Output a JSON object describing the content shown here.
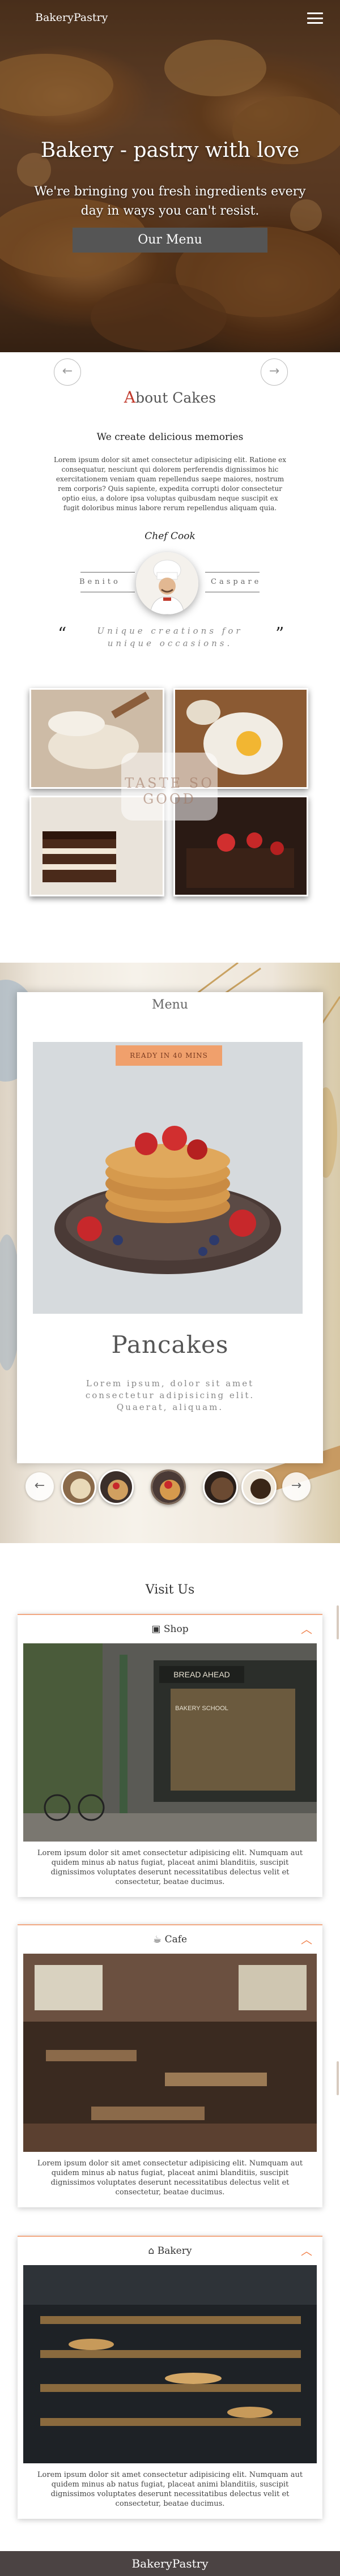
{
  "header": {
    "logo": "BakeryPastry",
    "menu_icon": "hamburger-icon"
  },
  "hero": {
    "title": "Bakery - pastry with love",
    "subtitle": "We're bringing you fresh ingredients every day in ways you can't resist.",
    "button": "Our Menu"
  },
  "about": {
    "prev_icon": "arrow-left-icon",
    "next_icon": "arrow-right-icon",
    "title_first": "A",
    "title_rest": "bout Cakes",
    "subtitle": "We create delicious memories",
    "text": "Lorem ipsum dolor sit amet consectetur adipisicing elit. Ratione ex consequatur, nesciunt qui dolorem perferendis dignissimos hic exercitationem veniam quam repellendus saepe maiores, nostrum rem corporis? Quis sapiente, expedita corrupti dolor consectetur optio eius, a dolore ipsa voluptas quibusdam neque suscipit ex fugit doloribus minus labore rerum repellendus aliquam quia.",
    "chef_label": "Chef Cook",
    "chef_first": "Benito",
    "chef_last": "Caspare",
    "quote": "Unique creations for unique occasions.",
    "quote_open": "“",
    "quote_close": "”"
  },
  "gallery": {
    "stamp_text": "TASTE SO GOOD"
  },
  "menu": {
    "heading": "Menu",
    "badge": "READY IN 40 MINS",
    "dish_title": "Pancakes",
    "dish_desc": "Lorem ipsum, dolor sit amet consectetur adipisicing elit. Quaerat, aliquam.",
    "prev_icon": "arrow-left-icon",
    "next_icon": "arrow-right-icon"
  },
  "visit": {
    "title": "Visit Us",
    "cards": [
      {
        "label": "Shop",
        "icon": "shop-icon",
        "text": "Lorem ipsum dolor sit amet consectetur adipisicing elit. Numquam aut quidem minus ab natus fugiat, placeat animi blanditiis, suscipit dignissimos voluptates deserunt necessitatibus delectus velit et consectetur, beatae ducimus."
      },
      {
        "label": "Cafe",
        "icon": "coffee-cup-icon",
        "text": "Lorem ipsum dolor sit amet consectetur adipisicing elit. Numquam aut quidem minus ab natus fugiat, placeat animi blanditiis, suscipit dignissimos voluptates deserunt necessitatibus delectus velit et consectetur, beatae ducimus."
      },
      {
        "label": "Bakery",
        "icon": "bank-building-icon",
        "text": "Lorem ipsum dolor sit amet consectetur adipisicing elit. Numquam aut quidem minus ab natus fugiat, placeat animi blanditiis, suscipit dignissimos voluptates deserunt necessitatibus delectus velit et consectetur, beatae ducimus."
      }
    ],
    "shop_sign": "BREAD AHEAD",
    "shop_sub_sign": "BAKERY SCHOOL"
  },
  "footer": {
    "logo": "BakeryPastry"
  },
  "colors": {
    "accent": "#f0804a",
    "badge": "#f0a06c",
    "footer": "#4b4343",
    "hero_button": "#555555"
  }
}
